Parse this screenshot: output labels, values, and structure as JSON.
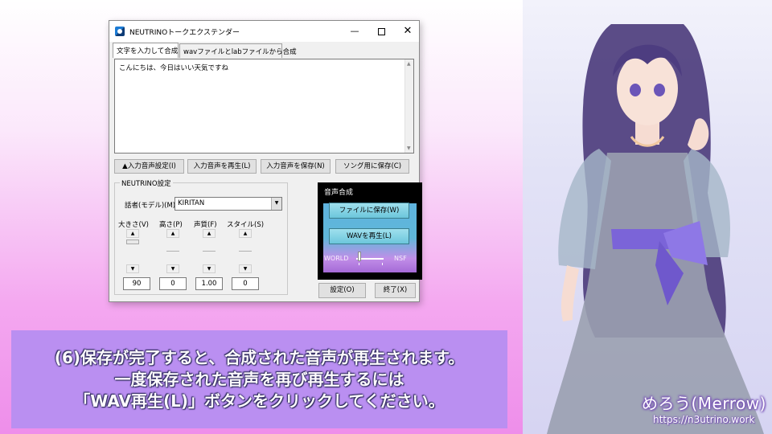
{
  "window": {
    "title": "NEUTRINOトークエクステンダー",
    "controls": {
      "minimize": "—",
      "close": "✕"
    }
  },
  "tabs": [
    {
      "label": "文字を入力して合成",
      "active": true
    },
    {
      "label": "wavファイルとlabファイルから合成",
      "active": false
    }
  ],
  "input_text": "こんにちは、今日はいい天気ですね",
  "buttons": {
    "input_voice_settings": "▲入力音声設定(I)",
    "play_input": "入力音声を再生(L)",
    "save_input": "入力音声を保存(N)",
    "save_for_song": "ソング用に保存(C)",
    "settings": "設定(O)",
    "exit": "終了(X)"
  },
  "neutrino_settings": {
    "group_title": "NEUTRINO設定",
    "speaker_label": "話者(モデル)(M)",
    "speaker_value": "KIRITAN",
    "params": [
      {
        "label": "大きさ(V)",
        "value": "90"
      },
      {
        "label": "高さ(P)",
        "value": "0"
      },
      {
        "label": "声質(F)",
        "value": "1.00"
      },
      {
        "label": "スタイル(S)",
        "value": "0"
      }
    ]
  },
  "synthesis": {
    "title": "音声合成",
    "save_file": "ファイルに保存(W)",
    "play_wav": "WAVを再生(L)",
    "left_label": "WORLD",
    "right_label": "NSF"
  },
  "caption": {
    "lines": [
      "(6)保存が完了すると、合成された音声が再生されます。",
      "一度保存された音声を再び再生するには",
      "「WAV再生(L)」ボタンをクリックしてください。"
    ]
  },
  "credit": {
    "name": "めろう(Merrow)",
    "url": "https://n3utrino.work"
  },
  "colors": {
    "caption_bg": "#b98ff2",
    "synth_button": "#9fe0ee",
    "accent_blue": "#0078d7"
  }
}
